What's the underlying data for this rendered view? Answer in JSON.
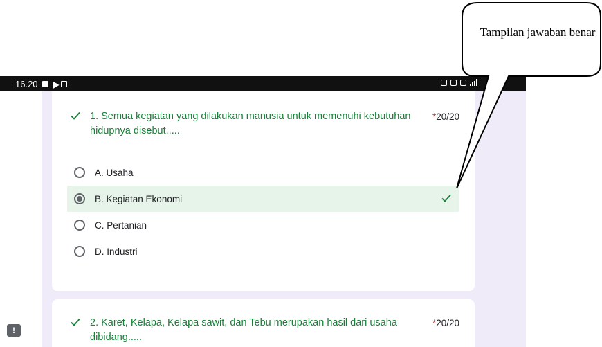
{
  "status_bar": {
    "time": "16.20"
  },
  "callout": {
    "text": "Tampilan jawaban benar"
  },
  "questions": [
    {
      "text": "1. Semua kegiatan yang dilakukan manusia untuk memenuhi kebutuhan hidupnya disebut.....",
      "required_mark": "*",
      "score": "20/20",
      "options": [
        {
          "label": "A. Usaha",
          "selected": false,
          "correct": false
        },
        {
          "label": "B. Kegiatan Ekonomi",
          "selected": true,
          "correct": true
        },
        {
          "label": "C. Pertanian",
          "selected": false,
          "correct": false
        },
        {
          "label": "D. Industri",
          "selected": false,
          "correct": false
        }
      ]
    },
    {
      "text": "2. Karet, Kelapa, Kelapa sawit, dan Tebu merupakan hasil dari usaha dibidang.....",
      "required_mark": "*",
      "score": "20/20"
    }
  ],
  "feedback_button": {
    "label": "!"
  },
  "colors": {
    "correct_green": "#188038",
    "correct_bg": "#e6f4ea",
    "required_red": "#d93025",
    "page_bg": "#f0ebf8"
  }
}
